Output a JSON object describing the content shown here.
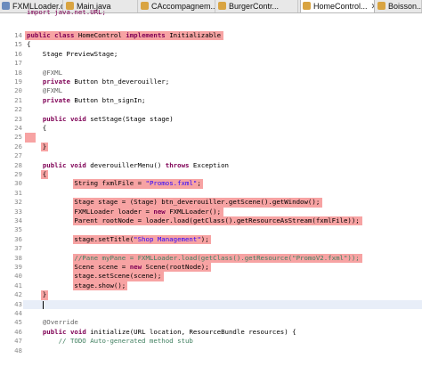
{
  "tabs": [
    {
      "label": "FXMLLoader.c...",
      "icon": "class-file-icon",
      "active": false
    },
    {
      "label": "Main.java",
      "icon": "java-file-icon",
      "active": false
    },
    {
      "label": "CAccompagnem...",
      "icon": "java-file-icon",
      "active": false
    },
    {
      "label": "BurgerContr...",
      "icon": "java-file-icon",
      "active": false
    },
    {
      "label": "HomeControl...",
      "icon": "java-file-icon",
      "active": true,
      "close": "✕"
    },
    {
      "label": "Boisson...",
      "icon": "java-file-icon",
      "active": false
    }
  ],
  "editor": {
    "partial_top_line": "import java.net.URL;",
    "lines": [
      {
        "num": "14",
        "text": "public class HomeControl implements Initializable",
        "highlight": true
      },
      {
        "num": "15",
        "text": "{",
        "highlight": false
      },
      {
        "num": "16",
        "text": "    Stage PreviewStage;",
        "highlight": false
      },
      {
        "num": "17",
        "text": "",
        "highlight": false
      },
      {
        "num": "18",
        "text": "    @FXML",
        "highlight": false
      },
      {
        "num": "19",
        "text": "    private Button btn_deverouiller;",
        "highlight": false
      },
      {
        "num": "20",
        "text": "    @FXML",
        "highlight": false
      },
      {
        "num": "21",
        "text": "    private Button btn_signIn;",
        "highlight": false
      },
      {
        "num": "22",
        "text": "",
        "highlight": false
      },
      {
        "num": "23",
        "text": "    public void setStage(Stage stage)",
        "highlight": false
      },
      {
        "num": "24",
        "text": "    {",
        "highlight": false
      },
      {
        "num": "25",
        "text": "",
        "highlight": true
      },
      {
        "num": "26",
        "text": "    }",
        "highlight": true
      },
      {
        "num": "27",
        "text": "",
        "highlight": false
      },
      {
        "num": "28",
        "text": "    public void deverouillerMenu() throws Exception",
        "highlight": false
      },
      {
        "num": "29",
        "text": "    {",
        "highlight": true
      },
      {
        "num": "30",
        "text": "            String fxmlFile = \"Promos.fxml\";",
        "highlight": true
      },
      {
        "num": "31",
        "text": "",
        "highlight": false
      },
      {
        "num": "32",
        "text": "            Stage stage = (Stage) btn_deverouiller.getScene().getWindow();",
        "highlight": true
      },
      {
        "num": "33",
        "text": "            FXMLLoader loader = new FXMLLoader();",
        "highlight": true
      },
      {
        "num": "34",
        "text": "            Parent rootNode = loader.load(getClass().getResourceAsStream(fxmlFile));",
        "highlight": true
      },
      {
        "num": "35",
        "text": "",
        "highlight": false
      },
      {
        "num": "36",
        "text": "            stage.setTitle(\"Shop Management\");",
        "highlight": true
      },
      {
        "num": "37",
        "text": "",
        "highlight": false
      },
      {
        "num": "38",
        "text": "            //Pane myPane = FXMLLoader.load(getClass().getResource(\"PromoV2.fxml\"));",
        "highlight": true
      },
      {
        "num": "39",
        "text": "            Scene scene = new Scene(rootNode);",
        "highlight": true
      },
      {
        "num": "40",
        "text": "            stage.setScene(scene);",
        "highlight": true
      },
      {
        "num": "41",
        "text": "            stage.show();",
        "highlight": true
      },
      {
        "num": "42",
        "text": "    }",
        "highlight": true
      },
      {
        "num": "43",
        "text": "",
        "highlight": false,
        "cursor": true
      },
      {
        "num": "44",
        "text": "",
        "highlight": false
      },
      {
        "num": "45",
        "text": "    @Override",
        "highlight": false
      },
      {
        "num": "46",
        "text": "    public void initialize(URL location, ResourceBundle resources) {",
        "highlight": false
      },
      {
        "num": "47",
        "text": "        // TODO Auto-generated method stub",
        "highlight": false
      },
      {
        "num": "48",
        "text": "",
        "highlight": false
      }
    ]
  },
  "colors": {
    "highlight": "#f7a3a3",
    "keyword": "#7f0055",
    "string": "#2a00ff",
    "field": "#0000c0",
    "comment": "#3f7f5f",
    "annotation": "#646464"
  }
}
